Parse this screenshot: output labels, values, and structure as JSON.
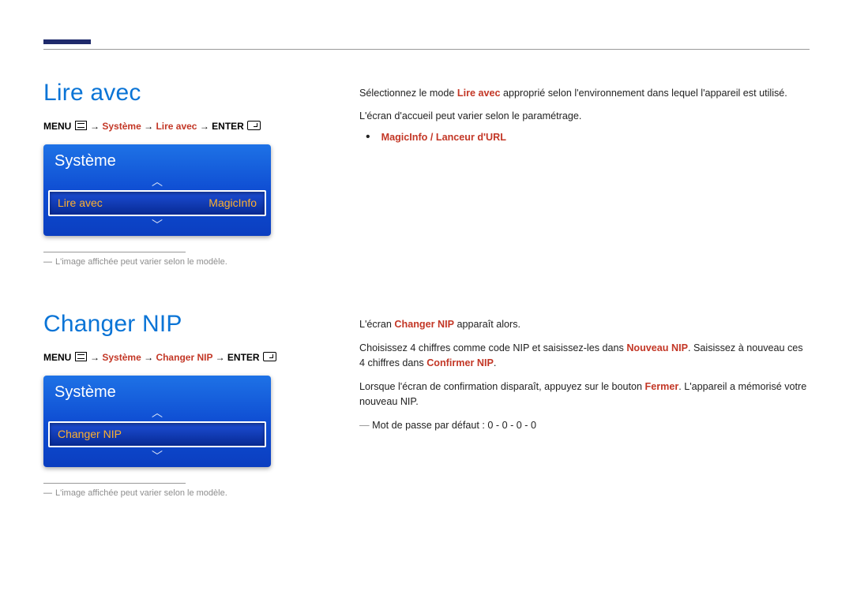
{
  "section1": {
    "title": "Lire avec",
    "menuPath": {
      "menuLabel": "MENU",
      "step1": "Système",
      "step2": "Lire avec",
      "enterLabel": "ENTER"
    },
    "osd": {
      "header": "Système",
      "rowLabel": "Lire avec",
      "rowValue": "MagicInfo"
    },
    "footnote": "L'image affichée peut varier selon le modèle.",
    "body": {
      "p1_before": "Sélectionnez le mode ",
      "p1_hl": "Lire avec",
      "p1_after": " approprié selon l'environnement dans lequel l'appareil est utilisé.",
      "p2": "L'écran d'accueil peut varier selon le paramétrage.",
      "bullet": "MagicInfo / Lanceur d'URL"
    }
  },
  "section2": {
    "title": "Changer NIP",
    "menuPath": {
      "menuLabel": "MENU",
      "step1": "Système",
      "step2": "Changer NIP",
      "enterLabel": "ENTER"
    },
    "osd": {
      "header": "Système",
      "rowLabel": "Changer NIP"
    },
    "footnote": "L'image affichée peut varier selon le modèle.",
    "body": {
      "p1_before": "L'écran ",
      "p1_hl": "Changer NIP",
      "p1_after": " apparaît alors.",
      "p2_before": "Choisissez 4 chiffres comme code NIP et saisissez-les dans ",
      "p2_hl1": "Nouveau NIP",
      "p2_mid": ". Saisissez à nouveau ces 4 chiffres dans ",
      "p2_hl2": "Confirmer NIP",
      "p2_after": ".",
      "p3_before": "Lorsque l'écran de confirmation disparaît, appuyez sur le bouton ",
      "p3_hl": "Fermer",
      "p3_after": ". L'appareil a mémorisé votre nouveau NIP.",
      "note": "Mot de passe par défaut : 0 - 0 - 0 - 0"
    }
  }
}
